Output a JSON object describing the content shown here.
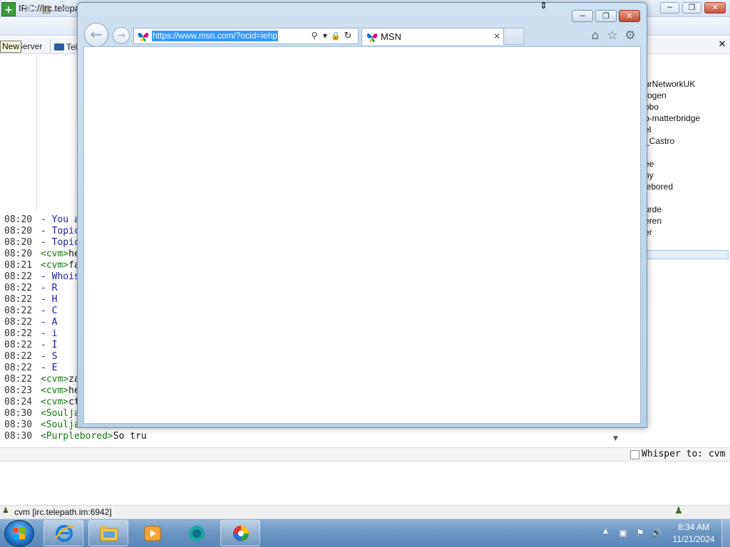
{
  "irc": {
    "title": "IRC://irc.telepath",
    "caption_buttons": {
      "minimize": "─",
      "maximize": "❐",
      "close": "✕"
    },
    "toolbar": {
      "new_icon": "+",
      "disconnect_icon": "✕",
      "properties_icon": "▤",
      "user_icon": "⚘"
    },
    "tooltip": "New",
    "tabs": [
      {
        "label": "Server"
      },
      {
        "label": "Tel"
      }
    ],
    "panel_close": "✕",
    "log": [
      {
        "time": "08:20",
        "kind": "system",
        "text": "- You a"
      },
      {
        "time": "08:20",
        "kind": "system",
        "text": "- Topic"
      },
      {
        "time": "08:20",
        "kind": "system",
        "text": "- Topic"
      },
      {
        "time": "08:20",
        "kind": "nick",
        "nick": "<cvm>",
        "text": "he"
      },
      {
        "time": "08:21",
        "kind": "nick",
        "nick": "<cvm>",
        "text": "fa"
      },
      {
        "time": "08:22",
        "kind": "system",
        "text": "- Whois"
      },
      {
        "time": "08:22",
        "kind": "system",
        "text": "   - R"
      },
      {
        "time": "08:22",
        "kind": "system",
        "text": "   - H"
      },
      {
        "time": "08:22",
        "kind": "system",
        "text": "   - C"
      },
      {
        "time": "08:22",
        "kind": "system",
        "text": "   - A"
      },
      {
        "time": "08:22",
        "kind": "system",
        "text": "   - i"
      },
      {
        "time": "08:22",
        "kind": "system",
        "text": "   - I"
      },
      {
        "time": "08:22",
        "kind": "system",
        "text": "   - S"
      },
      {
        "time": "08:22",
        "kind": "system",
        "text": "   - E"
      },
      {
        "time": "08:22",
        "kind": "nick",
        "nick": "<cvm>",
        "text": "za"
      },
      {
        "time": "08:23",
        "kind": "nick",
        "nick": "<cvm>",
        "text": "he"
      },
      {
        "time": "08:24",
        "kind": "nick",
        "nick": "<cvm>",
        "text": "ct"
      },
      {
        "time": "08:30",
        "kind": "nick",
        "nick": "<Soulja",
        "text": ""
      },
      {
        "time": "08:30",
        "kind": "nick",
        "nick": "<Soulja",
        "text": ""
      },
      {
        "time": "08:30",
        "kind": "nick",
        "nick": "<Purplebored>",
        "text": "So tru"
      }
    ],
    "users": [
      "urNetworkUK",
      "rogen",
      "obo",
      "p-matterbridge",
      "el",
      "_Castro",
      "ee",
      "ny",
      "lebored",
      "urde",
      "eren",
      "er"
    ],
    "whisper_label": "Whisper to: cvm",
    "status_text": "cvm  [irc.telepath.im:6942]",
    "scroll_down_icon": "▼"
  },
  "taskbar": {
    "items": [
      {
        "name": "internet-explorer"
      },
      {
        "name": "windows-explorer"
      },
      {
        "name": "media-player"
      },
      {
        "name": "chat-app"
      },
      {
        "name": "irc-client"
      }
    ],
    "tray_chevron": "▲",
    "tray_icons": {
      "network": "▣",
      "flag": "⚑",
      "volume": "🔊"
    },
    "clock_time": "8:34 AM",
    "clock_date": "11/21/2024"
  },
  "browser": {
    "caption_buttons": {
      "minimize": "─",
      "maximize": "❐",
      "close": "✕"
    },
    "back_icon": "←",
    "forward_icon": "→",
    "url": "https://www.msn.com/?ocid=iehp",
    "address_icons": {
      "search": "⚲",
      "dropdown": "▼",
      "lock": "🔒",
      "refresh": "↻"
    },
    "tab_title": "MSN",
    "tab_close": "✕",
    "commands": {
      "home": "⌂",
      "favorites": "☆",
      "tools": "⚙"
    }
  },
  "colors": {
    "selection": "#3399ff",
    "system_text": "#1a1aa6",
    "nick_text": "#127a12"
  }
}
